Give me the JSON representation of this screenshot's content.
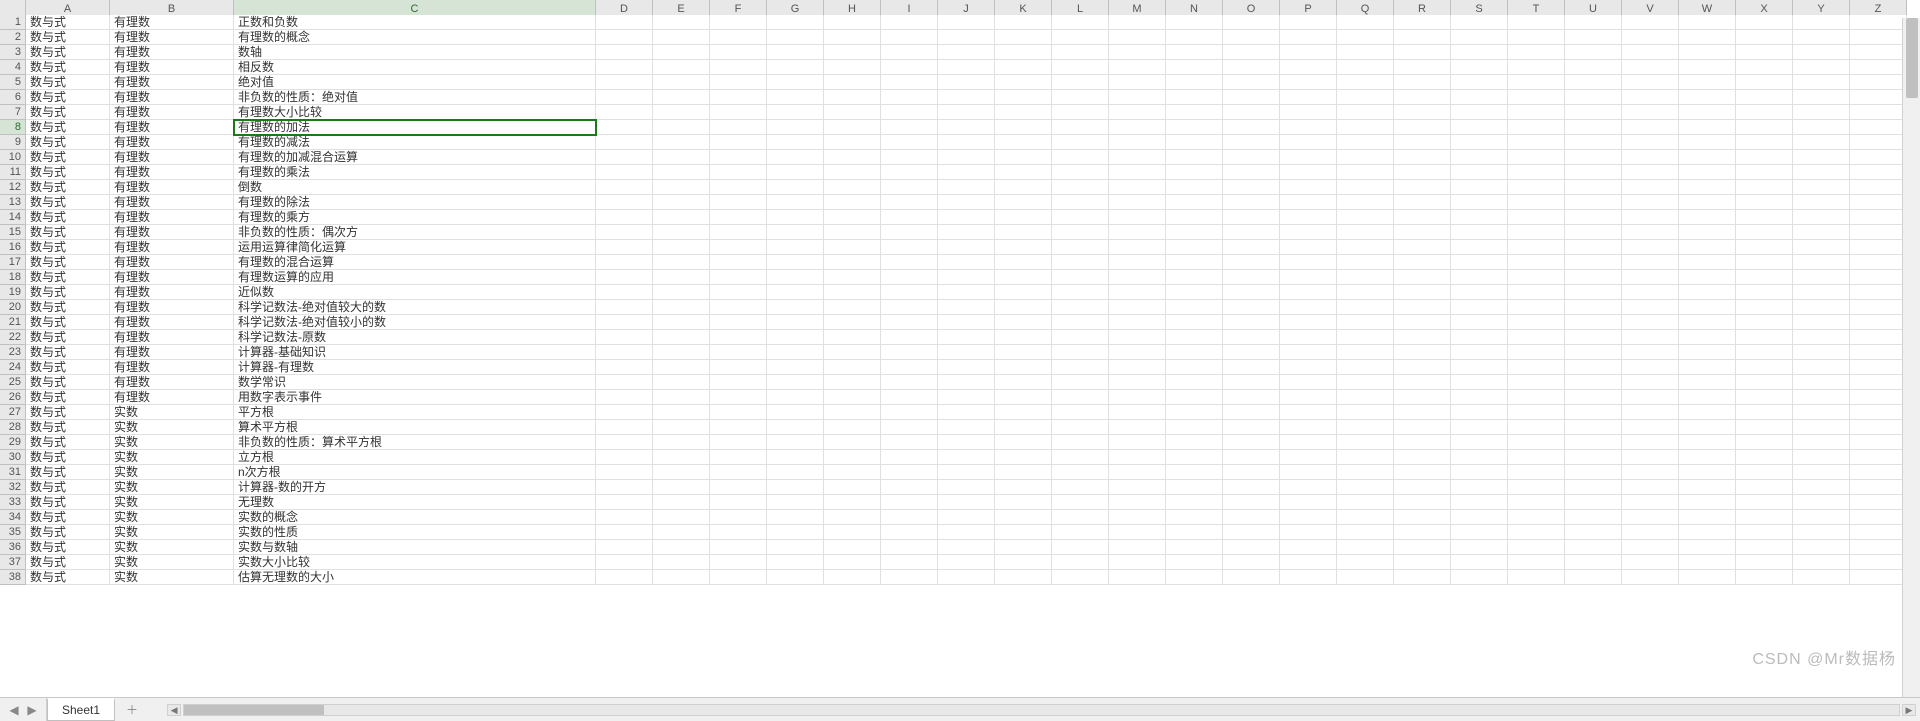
{
  "columns": [
    "A",
    "B",
    "C",
    "D",
    "E",
    "F",
    "G",
    "H",
    "I",
    "J",
    "K",
    "L",
    "M",
    "N",
    "O",
    "P",
    "Q",
    "R",
    "S",
    "T",
    "U",
    "V",
    "W",
    "X",
    "Y",
    "Z"
  ],
  "col_widths": {
    "A": 84,
    "B": 124,
    "C": 362,
    "default": 57
  },
  "visible_row_count": 38,
  "active_cell": {
    "row": 8,
    "col": "C"
  },
  "sheet_tab": {
    "name": "Sheet1"
  },
  "watermark": "CSDN @Mr数据杨",
  "rows": [
    {
      "A": "数与式",
      "B": "有理数",
      "C": "正数和负数"
    },
    {
      "A": "数与式",
      "B": "有理数",
      "C": "有理数的概念"
    },
    {
      "A": "数与式",
      "B": "有理数",
      "C": "数轴"
    },
    {
      "A": "数与式",
      "B": "有理数",
      "C": "相反数"
    },
    {
      "A": "数与式",
      "B": "有理数",
      "C": "绝对值"
    },
    {
      "A": "数与式",
      "B": "有理数",
      "C": "非负数的性质：绝对值"
    },
    {
      "A": "数与式",
      "B": "有理数",
      "C": "有理数大小比较"
    },
    {
      "A": "数与式",
      "B": "有理数",
      "C": "有理数的加法"
    },
    {
      "A": "数与式",
      "B": "有理数",
      "C": "有理数的减法"
    },
    {
      "A": "数与式",
      "B": "有理数",
      "C": "有理数的加减混合运算"
    },
    {
      "A": "数与式",
      "B": "有理数",
      "C": "有理数的乘法"
    },
    {
      "A": "数与式",
      "B": "有理数",
      "C": "倒数"
    },
    {
      "A": "数与式",
      "B": "有理数",
      "C": "有理数的除法"
    },
    {
      "A": "数与式",
      "B": "有理数",
      "C": "有理数的乘方"
    },
    {
      "A": "数与式",
      "B": "有理数",
      "C": "非负数的性质：偶次方"
    },
    {
      "A": "数与式",
      "B": "有理数",
      "C": "运用运算律简化运算"
    },
    {
      "A": "数与式",
      "B": "有理数",
      "C": "有理数的混合运算"
    },
    {
      "A": "数与式",
      "B": "有理数",
      "C": "有理数运算的应用"
    },
    {
      "A": "数与式",
      "B": "有理数",
      "C": "近似数"
    },
    {
      "A": "数与式",
      "B": "有理数",
      "C": "科学记数法-绝对值较大的数"
    },
    {
      "A": "数与式",
      "B": "有理数",
      "C": "科学记数法-绝对值较小的数"
    },
    {
      "A": "数与式",
      "B": "有理数",
      "C": "科学记数法-原数"
    },
    {
      "A": "数与式",
      "B": "有理数",
      "C": "计算器-基础知识"
    },
    {
      "A": "数与式",
      "B": "有理数",
      "C": "计算器-有理数"
    },
    {
      "A": "数与式",
      "B": "有理数",
      "C": "数学常识"
    },
    {
      "A": "数与式",
      "B": "有理数",
      "C": "用数字表示事件"
    },
    {
      "A": "数与式",
      "B": "实数",
      "C": "平方根"
    },
    {
      "A": "数与式",
      "B": "实数",
      "C": "算术平方根"
    },
    {
      "A": "数与式",
      "B": "实数",
      "C": "非负数的性质：算术平方根"
    },
    {
      "A": "数与式",
      "B": "实数",
      "C": "立方根"
    },
    {
      "A": "数与式",
      "B": "实数",
      "C": "n次方根"
    },
    {
      "A": "数与式",
      "B": "实数",
      "C": "计算器-数的开方"
    },
    {
      "A": "数与式",
      "B": "实数",
      "C": "无理数"
    },
    {
      "A": "数与式",
      "B": "实数",
      "C": "实数的概念"
    },
    {
      "A": "数与式",
      "B": "实数",
      "C": "实数的性质"
    },
    {
      "A": "数与式",
      "B": "实数",
      "C": "实数与数轴"
    },
    {
      "A": "数与式",
      "B": "实数",
      "C": "实数大小比较"
    },
    {
      "A": "数与式",
      "B": "实数",
      "C": "估算无理数的大小"
    }
  ]
}
